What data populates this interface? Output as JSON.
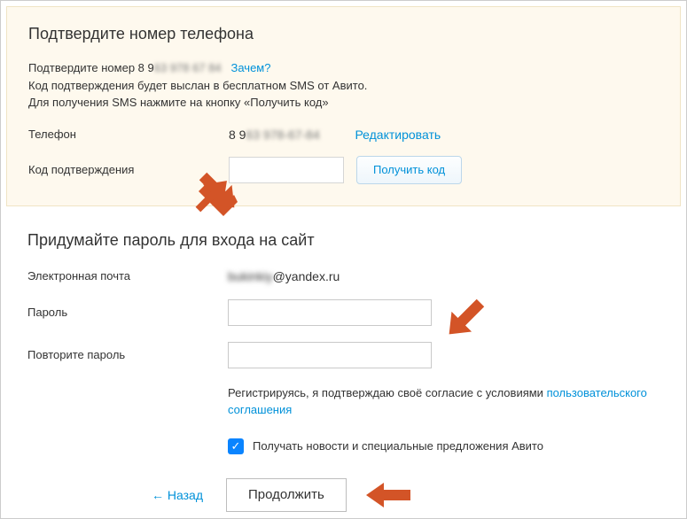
{
  "phone_section": {
    "title": "Подтвердите номер телефона",
    "confirm_prefix": "Подтвердите номер ",
    "confirm_num_prefix": "8 9",
    "confirm_num_blur": "63 978 67 84",
    "why_link": "Зачем?",
    "info_line2": "Код подтверждения будет выслан в бесплатном SMS от Авито.",
    "info_line3": "Для получения SMS нажмите на кнопку «Получить код»",
    "phone_label": "Телефон",
    "phone_display_prefix": "8 9",
    "phone_display_blur": "63 978-67-84",
    "edit_link": "Редактировать",
    "code_label": "Код подтверждения",
    "get_code_btn": "Получить код"
  },
  "password_section": {
    "title": "Придумайте пароль для входа на сайт",
    "email_label": "Электронная почта",
    "email_local_blur": "bukinkiy",
    "email_domain": "@yandex.ru",
    "password_label": "Пароль",
    "confirm_password_label": "Повторите пароль",
    "terms_text": "Регистрируясь, я подтверждаю своё согласие с условиями ",
    "terms_link": "пользовательского соглашения",
    "news_checkbox_label": "Получать новости и специальные предложения Авито",
    "news_checked": true,
    "back_link": "← Назад",
    "continue_btn": "Продолжить"
  }
}
